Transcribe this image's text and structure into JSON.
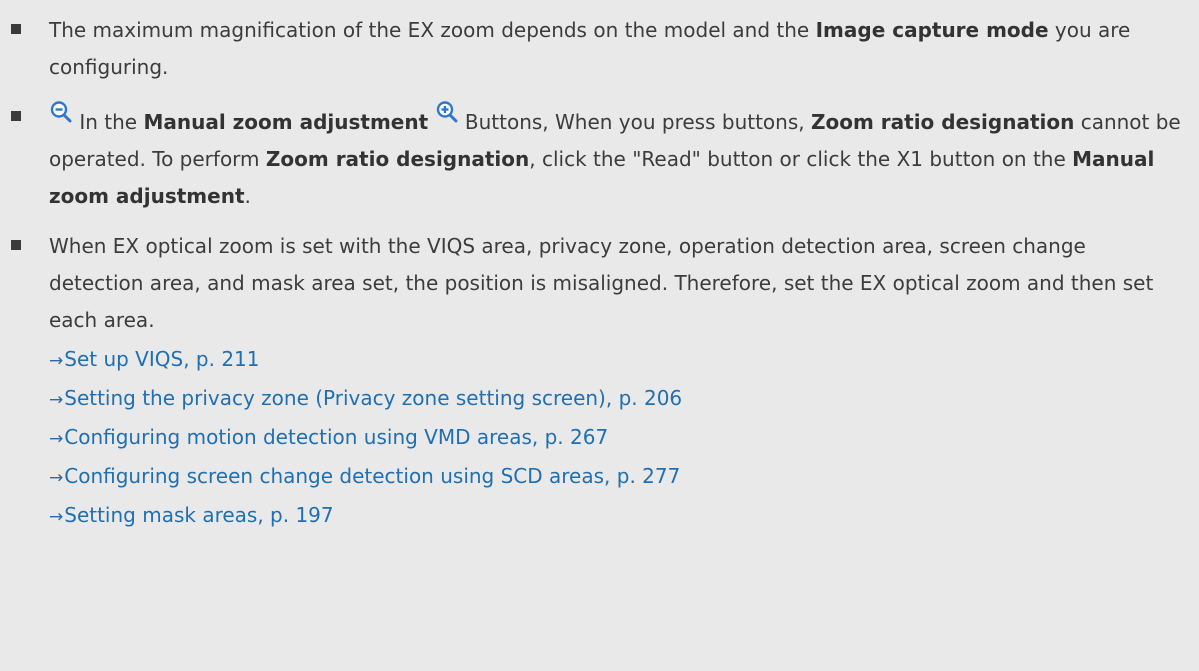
{
  "notes": [
    {
      "p1": "The maximum magnification of the EX zoom depends on the model and the ",
      "b1": "Image capture mode",
      "p2": " you are configuring."
    },
    {
      "p1": " In the ",
      "b1": "Manual zoom adjustment",
      "p2": " Buttons, When you press buttons, ",
      "b2": "Zoom ratio designation",
      "p3": " cannot be operated. To perform ",
      "b3": "Zoom ratio designation",
      "p4": ", click the \"Read\" but­ton or click the X1 button on the ",
      "b4": "Manual zoom adjustment",
      "p5": "."
    },
    {
      "p1": "When EX optical zoom is set with the VIQS area, privacy zone, operation detection area, screen change detection area, and mask area set, the position is misaligned. Therefore, set the EX optical zoom and then set each area."
    }
  ],
  "links": [
    {
      "arrow": "→",
      "text": "Set up VIQS, p. 211"
    },
    {
      "arrow": "→",
      "text": "Setting the privacy zone (Privacy zone setting screen), p. 206"
    },
    {
      "arrow": "→",
      "text": "Configuring motion detection using VMD areas, p. 267"
    },
    {
      "arrow": "→",
      "text": "Configuring screen change detection using SCD areas, p. 277"
    },
    {
      "arrow": "→",
      "text": "Setting mask areas, p. 197"
    }
  ],
  "colors": {
    "background": "#e9e9e9",
    "text": "#3c3c3c",
    "link": "#1f6fb2",
    "icon": "#2f78c8"
  },
  "icons": {
    "zoom_out": "zoom-out-icon",
    "zoom_in": "zoom-in-icon"
  }
}
